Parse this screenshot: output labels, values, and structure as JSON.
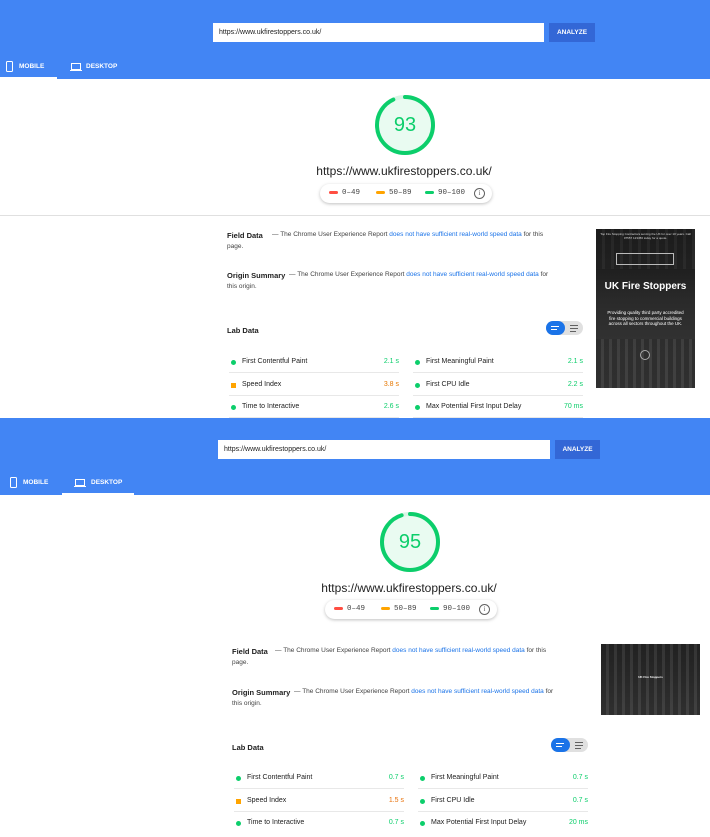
{
  "colors": {
    "header": "#4285f4",
    "pass": "#0cce6b",
    "average": "#ffa400",
    "fail": "#ff4e42",
    "link": "#1a73e8"
  },
  "panels": [
    {
      "id": "mobile",
      "url_value": "https://www.ukfirestoppers.co.uk/",
      "analyze_label": "ANALYZE",
      "tabs": {
        "mobile": "MOBILE",
        "desktop": "DESKTOP"
      },
      "score": "93",
      "score_fraction": 0.93,
      "site_url": "https://www.ukfirestoppers.co.uk/",
      "legend": {
        "fail": "0–49",
        "average": "50–89",
        "pass": "90–100"
      },
      "field_data": {
        "title": "Field Data",
        "prefix": " — The Chrome User Experience Report ",
        "link": "does not have sufficient real-world speed data",
        "suffix": " for this page."
      },
      "origin_summary": {
        "title": "Origin Summary",
        "prefix": " — The Chrome User Experience Report ",
        "link": "does not have sufficient real-world speed data",
        "suffix": " for this origin."
      },
      "lab_title": "Lab Data",
      "metrics_left": [
        {
          "name": "First Contentful Paint",
          "value": "2.1 s",
          "status": "pass"
        },
        {
          "name": "Speed Index",
          "value": "3.8 s",
          "status": "average"
        },
        {
          "name": "Time to Interactive",
          "value": "2.6 s",
          "status": "pass"
        }
      ],
      "metrics_right": [
        {
          "name": "First Meaningful Paint",
          "value": "2.1 s",
          "status": "pass"
        },
        {
          "name": "First CPU Idle",
          "value": "2.2 s",
          "status": "pass"
        },
        {
          "name": "Max Potential First Input Delay",
          "value": "70 ms",
          "status": "pass"
        }
      ],
      "thumb": {
        "banner": "Top Fire Stopping Contractors serving the UK for over 10 years. Call 07557 123456 today for a quote.",
        "heading": "UK Fire Stoppers",
        "body": "Providing quality third party accredited fire stopping to commercial buildings across all sectors throughout the UK."
      }
    },
    {
      "id": "desktop",
      "url_value": "https://www.ukfirestoppers.co.uk/",
      "analyze_label": "ANALYZE",
      "tabs": {
        "mobile": "MOBILE",
        "desktop": "DESKTOP"
      },
      "score": "95",
      "score_fraction": 0.95,
      "site_url": "https://www.ukfirestoppers.co.uk/",
      "legend": {
        "fail": "0–49",
        "average": "50–89",
        "pass": "90–100"
      },
      "field_data": {
        "title": "Field Data",
        "prefix": " — The Chrome User Experience Report ",
        "link": "does not have sufficient real-world speed data",
        "suffix": " for this page."
      },
      "origin_summary": {
        "title": "Origin Summary",
        "prefix": " — The Chrome User Experience Report ",
        "link": "does not have sufficient real-world speed data",
        "suffix": " for this origin."
      },
      "lab_title": "Lab Data",
      "metrics_left": [
        {
          "name": "First Contentful Paint",
          "value": "0.7 s",
          "status": "pass"
        },
        {
          "name": "Speed Index",
          "value": "1.5 s",
          "status": "average"
        },
        {
          "name": "Time to Interactive",
          "value": "0.7 s",
          "status": "pass"
        }
      ],
      "metrics_right": [
        {
          "name": "First Meaningful Paint",
          "value": "0.7 s",
          "status": "pass"
        },
        {
          "name": "First CPU Idle",
          "value": "0.7 s",
          "status": "pass"
        },
        {
          "name": "Max Potential First Input Delay",
          "value": "20 ms",
          "status": "pass"
        }
      ],
      "thumb": {
        "heading": "UK Fire Stoppers"
      }
    }
  ]
}
